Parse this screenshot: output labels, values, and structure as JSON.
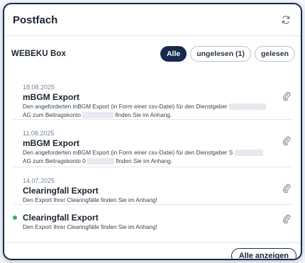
{
  "header": {
    "title": "Postfach",
    "refresh_icon": "refresh-icon"
  },
  "box": {
    "label": "WEBEKU Box",
    "filters": [
      {
        "label": "Alle",
        "active": true
      },
      {
        "label": "ungelesen (1)",
        "active": false
      },
      {
        "label": "gelesen",
        "active": false
      }
    ]
  },
  "messages": [
    {
      "date": "18.08.2025",
      "subject": "mBGM Export",
      "body_line1": "Den angeforderten mBGM Export (in Form einer csv-Datei) für den Dienstgeber",
      "body_line2a": "AG zum Beitragskonto",
      "body_line2b": "finden Sie im Anhang.",
      "attachment_icon": "paperclip-icon",
      "unread": false
    },
    {
      "date": "11.08.2025",
      "subject": "mBGM Export",
      "body_line1": "Den angeforderten mBGM Export (in Form einer csv-Datei) für den Dienstgeber",
      "body_line1b": "S",
      "body_line2a": "AG zum Beitragskonto 0",
      "body_line2b": "finden Sie im Anhang.",
      "attachment_icon": "paperclip-icon",
      "unread": false
    },
    {
      "date": "14.07.2025",
      "subject": "Clearingfall Export",
      "body_line1": "Den Export Ihrer Clearingfälle finden Sie im Anhang!",
      "attachment_icon": "paperclip-icon",
      "unread": false
    },
    {
      "date": "",
      "subject": "Clearingfall Export",
      "body_line1": "Den Export Ihrer Clearingfälle finden Sie im Anhang!",
      "attachment_icon": "paperclip-icon",
      "unread": true
    }
  ],
  "footer": {
    "show_all_label": "Alle anzeigen"
  },
  "colors": {
    "navy": "#172a4e",
    "unread_dot": "#23b36a"
  }
}
